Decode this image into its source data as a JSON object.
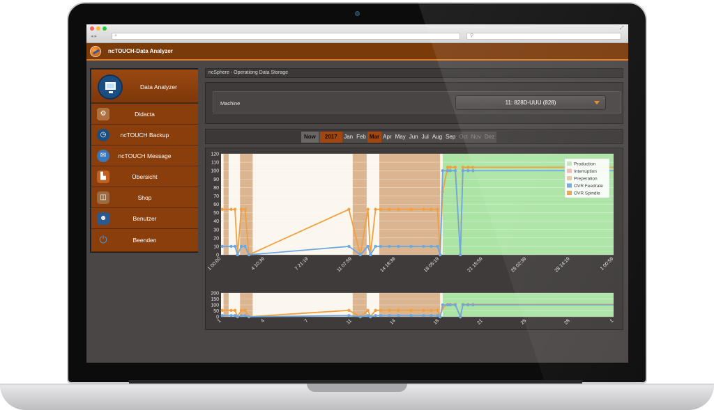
{
  "app": {
    "title": "ncTOUCH-Data Analyzer",
    "accent": "#e07a1c",
    "header_color": "#7a3a0a"
  },
  "browser": {
    "new_tab_icon": "plus-icon",
    "search_icon": "search-icon"
  },
  "sidebar": {
    "items": [
      {
        "label": "Data Analyzer",
        "icon": "monitor-icon",
        "active": true
      },
      {
        "label": "Didacta",
        "icon": "machine-icon"
      },
      {
        "label": "ncTOUCH Backup",
        "icon": "clock-icon"
      },
      {
        "label": "ncTOUCH Message",
        "icon": "envelope-icon"
      },
      {
        "label": "Übersicht",
        "icon": "factory-icon"
      },
      {
        "label": "Shop",
        "icon": "bag-icon"
      },
      {
        "label": "Benutzer",
        "icon": "user-edit-icon"
      },
      {
        "label": "Beenden",
        "icon": "power-icon"
      }
    ]
  },
  "content": {
    "section_title": "ncSphere - Operationg Data Storage",
    "machine": {
      "label": "Machine",
      "selected": "11: 828D-UUU (828)"
    },
    "period": {
      "now_label": "Now",
      "year": "2017",
      "months": [
        "Jan",
        "Feb",
        "Mar",
        "Apr",
        "May",
        "Jun",
        "Jul",
        "Aug",
        "Sep",
        "Oct",
        "Nov",
        "Dez"
      ],
      "selected_month": "Mar",
      "disabled_months": [
        "Oct",
        "Nov",
        "Dez"
      ]
    }
  },
  "chart_data": [
    {
      "type": "line",
      "ylim": [
        0,
        120
      ],
      "yticks": [
        0,
        10,
        20,
        30,
        40,
        50,
        60,
        70,
        80,
        90,
        100,
        110,
        120
      ],
      "xlim": [
        1,
        32
      ],
      "xtick_labels": [
        "1 00:00",
        "4 10:39",
        "7 21:19",
        "11 07:59",
        "14 18:39",
        "18 05:19",
        "21 15:59",
        "25 02:39",
        "28 14:19",
        "1 00:59"
      ],
      "grid": true,
      "legend_position": "top-right",
      "legend": [
        {
          "name": "Production",
          "color": "#bfe8b8"
        },
        {
          "name": "Interruption",
          "color": "#f2b8b0"
        },
        {
          "name": "Preperation",
          "color": "#e8c9a0"
        },
        {
          "name": "OVR Feedrate",
          "color": "#6fa8e0"
        },
        {
          "name": "OVR Spindle",
          "color": "#f0a040"
        }
      ],
      "bands": [
        {
          "state": "Preperation",
          "x0": 1.2,
          "x1": 1.6
        },
        {
          "state": "Preperation",
          "x0": 2.5,
          "x1": 3.5
        },
        {
          "state": "Preperation",
          "x0": 11.4,
          "x1": 12.5
        },
        {
          "state": "Preperation",
          "x0": 13.5,
          "x1": 18.3
        },
        {
          "state": "Production",
          "x0": 18.5,
          "x1": 32
        }
      ],
      "series": [
        {
          "name": "OVR Spindle",
          "x": [
            1.1,
            1.8,
            2.1,
            2.3,
            2.6,
            2.9,
            3.2,
            11.1,
            12.0,
            12.6,
            12.8,
            13.2,
            13.6,
            14.3,
            15.0,
            16.0,
            17.0,
            17.6,
            18.1,
            18.3,
            18.5,
            18.9,
            19.1,
            19.5,
            19.9,
            20.1,
            20.5,
            20.9,
            32
          ],
          "y": [
            54,
            54,
            54,
            0,
            54,
            54,
            0,
            54,
            0,
            54,
            0,
            54,
            54,
            54,
            54,
            54,
            54,
            54,
            54,
            0,
            75,
            104,
            104,
            104,
            0,
            104,
            104,
            104,
            104
          ]
        },
        {
          "name": "OVR Feedrate",
          "x": [
            1.1,
            1.8,
            2.1,
            2.3,
            2.6,
            2.9,
            3.2,
            11.1,
            12.0,
            12.6,
            12.8,
            13.2,
            13.6,
            14.3,
            15.0,
            16.0,
            17.0,
            17.6,
            18.1,
            18.3,
            18.5,
            18.9,
            19.1,
            19.5,
            19.9,
            20.1,
            20.5,
            20.9,
            32
          ],
          "y": [
            10,
            10,
            10,
            0,
            10,
            10,
            0,
            10,
            0,
            10,
            0,
            10,
            10,
            10,
            10,
            10,
            10,
            10,
            10,
            0,
            100,
            100,
            100,
            100,
            0,
            100,
            100,
            100,
            100
          ]
        }
      ]
    },
    {
      "type": "line",
      "ylim": [
        0,
        200
      ],
      "yticks": [
        0,
        50,
        100,
        150,
        200
      ],
      "xlim": [
        1,
        32
      ],
      "xtick_labels": [
        "1",
        "4",
        "7",
        "11",
        "14",
        "18",
        "21",
        "25",
        "28",
        "1"
      ],
      "grid": true
    }
  ]
}
